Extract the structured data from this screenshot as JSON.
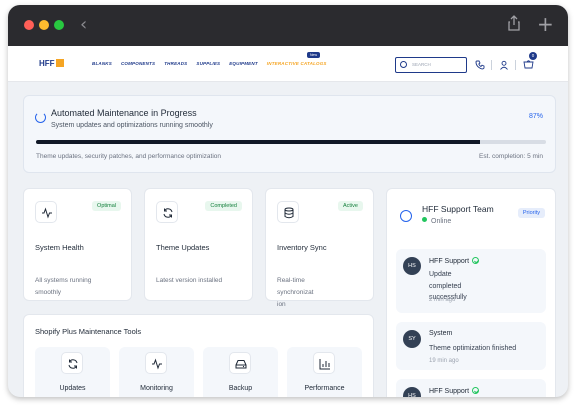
{
  "browser": {
    "back_glyph": "‹",
    "new_tab_glyph": "+",
    "traffic_lights": [
      "#ff5f57",
      "#febc2e",
      "#28c840"
    ]
  },
  "nav": {
    "logo_text": "HFF",
    "menu": [
      "BLANKS",
      "COMPONENTS",
      "THREADS",
      "SUPPLIES",
      "EQUIPMENT",
      "INTERACTIVE CATALOGS"
    ],
    "new_badge": "New",
    "search_placeholder": "SEARCH",
    "cart_count": "0",
    "icons": [
      "phone-icon",
      "user-icon",
      "cart-icon"
    ]
  },
  "maintenance": {
    "title": "Automated Maintenance in Progress",
    "subtitle": "System updates and optimizations running smoothly",
    "percent_label": "87%",
    "progress": 0.87,
    "footer": "Theme updates, security patches, and performance optimization",
    "eta": "Est. completion: 5 min"
  },
  "status_cards": [
    {
      "icon": "activity-icon",
      "badge": "Optimal",
      "name": "System Health",
      "desc_lines": [
        "All systems running",
        "smoothly"
      ]
    },
    {
      "icon": "refresh-icon",
      "badge": "Completed",
      "name": "Theme Updates",
      "desc_lines": [
        "Latest version installed"
      ]
    },
    {
      "icon": "database-icon",
      "badge": "Active",
      "name": "Inventory Sync",
      "desc_lines": [
        "Real-time",
        "synchronizat",
        "ion"
      ]
    }
  ],
  "tools": {
    "title": "Shopify Plus Maintenance Tools",
    "items": [
      {
        "icon": "refresh-icon",
        "label": "Updates"
      },
      {
        "icon": "activity-icon",
        "label": "Monitoring"
      },
      {
        "icon": "hard-drive-icon",
        "label": "Backup"
      },
      {
        "icon": "bar-chart-icon",
        "label": "Performance"
      }
    ]
  },
  "support": {
    "title": "HFF Support Team",
    "status": "Online",
    "priority": "Priority",
    "messages": [
      {
        "initials": "HS",
        "from": "HFF Support",
        "verified": true,
        "text_lines": [
          "Update",
          "completed",
          "successfully"
        ],
        "time": "2 min ago"
      },
      {
        "initials": "SY",
        "from": "System",
        "verified": false,
        "text_lines": [
          "Theme optimization finished"
        ],
        "time": "19 min ago"
      },
      {
        "initials": "HS",
        "from": "HFF Support",
        "verified": true,
        "text_lines": [],
        "time": ""
      }
    ]
  },
  "colors": {
    "brand_navy": "#1f3a8a",
    "accent_orange": "#f5a524",
    "accent_blue": "#2563eb",
    "success_green": "#15803d"
  }
}
